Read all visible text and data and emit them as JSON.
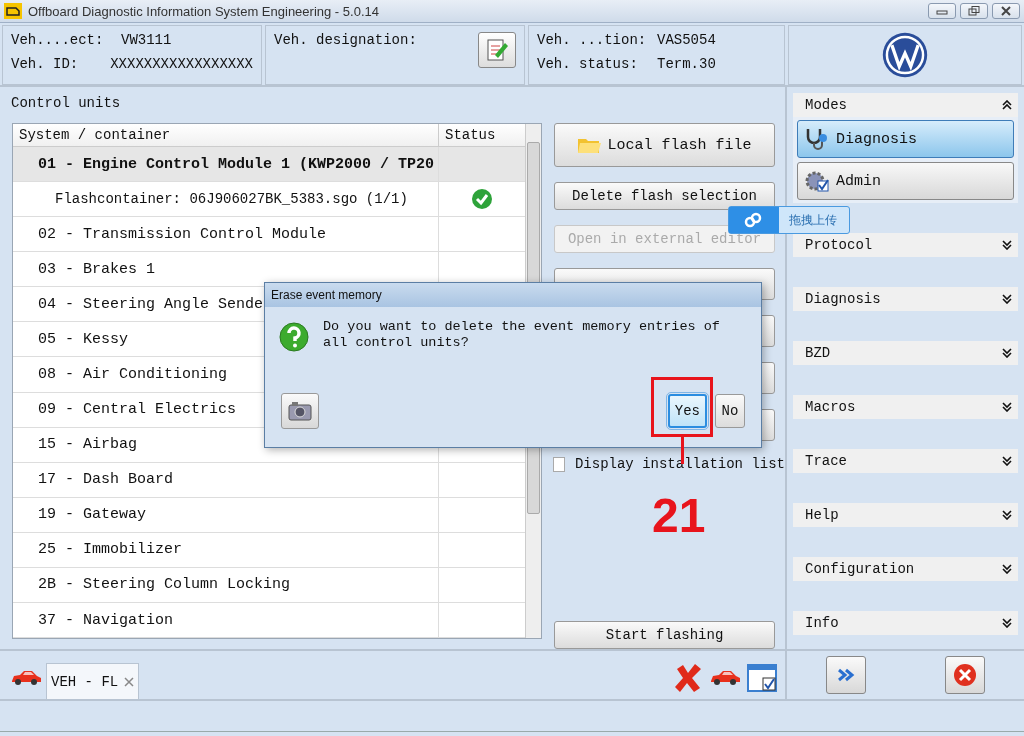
{
  "window": {
    "title": "Offboard Diagnostic Information System Engineering - 5.0.14"
  },
  "header": {
    "fields": [
      {
        "label": "Veh....ect:",
        "value": "VW3111"
      },
      {
        "label": "Veh. ID:",
        "value": "XXXXXXXXXXXXXXXXX"
      }
    ],
    "designation": {
      "label": "Veh. designation:"
    },
    "fields_right": [
      {
        "label": "Veh. ...tion:",
        "value": "VAS5054"
      },
      {
        "label": "Veh. status:",
        "value": "Term.30"
      }
    ]
  },
  "control_units": {
    "title": "Control units",
    "columns": [
      "System / container",
      "Status"
    ],
    "rows": [
      {
        "name": "01 - Engine Control Module 1  (KWP2000 / TP20",
        "selected": true,
        "expanded": true,
        "children": [
          {
            "name": "Flashcontainer: 06J906027BK_5383.sgo (1/1)",
            "ok": true
          }
        ]
      },
      {
        "name": "02 - Transmission Control Module",
        "selected": false
      },
      {
        "name": "03 - Brakes 1",
        "selected": false
      },
      {
        "name": "04 - Steering Angle Sende",
        "selected": false
      },
      {
        "name": "05 - Kessy",
        "selected": false
      },
      {
        "name": "08 - Air Conditioning",
        "selected": false
      },
      {
        "name": "09 - Central Electrics",
        "selected": false
      },
      {
        "name": "15 - Airbag",
        "selected": false
      },
      {
        "name": "17 - Dash Board",
        "selected": false
      },
      {
        "name": "19 - Gateway",
        "selected": false
      },
      {
        "name": "25 - Immobilizer",
        "selected": false
      },
      {
        "name": "2B - Steering Column Locking",
        "selected": false
      },
      {
        "name": "37 - Navigation",
        "selected": false
      }
    ]
  },
  "actions": [
    {
      "kind": "button",
      "label": "Local flash file",
      "disabled": false
    },
    {
      "kind": "button",
      "label": "Delete flash selection",
      "disabled": false
    },
    {
      "kind": "button",
      "label": "Open in external editor",
      "disabled": true
    },
    {
      "kind": "covered"
    },
    {
      "kind": "covered"
    },
    {
      "kind": "covered"
    },
    {
      "kind": "covered"
    },
    {
      "kind": "checkbox",
      "label": "Display installation list",
      "checked": false
    },
    {
      "kind": "spacer"
    },
    {
      "kind": "button",
      "label": "Start flashing",
      "disabled": false
    }
  ],
  "upload_tooltip": {
    "label": "拖拽上传"
  },
  "sidebar": {
    "sections": [
      {
        "title": "Modes",
        "expanded": true,
        "items": [
          {
            "label": "Diagnosis",
            "selected": true
          },
          {
            "label": "Admin",
            "selected": false
          }
        ]
      },
      {
        "title": "Protocol",
        "expanded": false
      },
      {
        "title": "Diagnosis",
        "expanded": false
      },
      {
        "title": "BZD",
        "expanded": false
      },
      {
        "title": "Macros",
        "expanded": false
      },
      {
        "title": "Trace",
        "expanded": false
      },
      {
        "title": "Help",
        "expanded": false
      },
      {
        "title": "Configuration",
        "expanded": false
      },
      {
        "title": "Info",
        "expanded": false
      }
    ]
  },
  "tabs": [
    {
      "label": "VEH - FL",
      "selected": true
    }
  ],
  "dialog": {
    "title": "Erase event memory",
    "message": "Do you want to delete the event memory entries of all control units?",
    "buttons": [
      {
        "label": "Yes",
        "selected": true
      },
      {
        "label": "No",
        "selected": false
      }
    ]
  },
  "annotation": {
    "label": "21"
  }
}
